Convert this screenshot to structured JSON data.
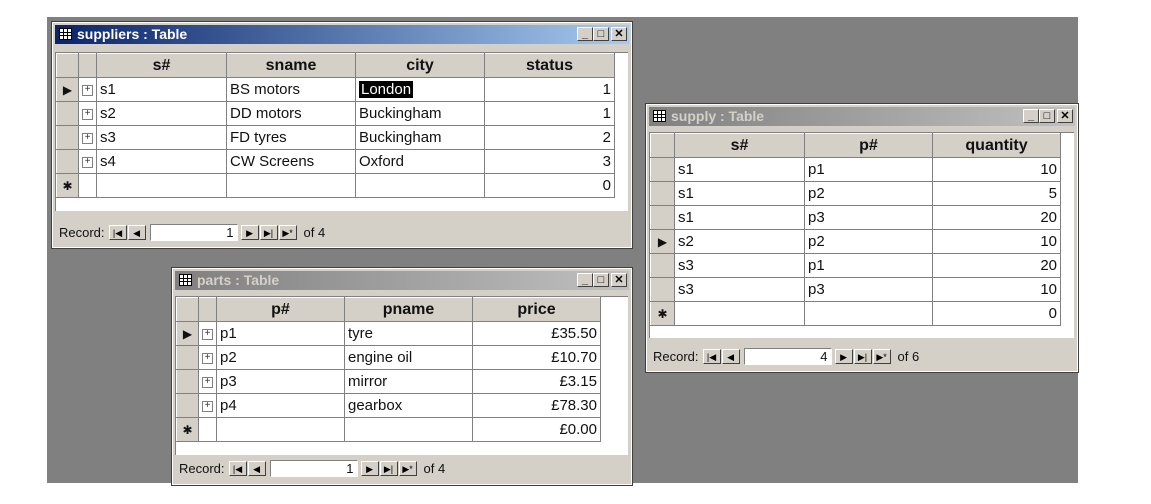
{
  "windows": {
    "suppliers": {
      "title": "suppliers : Table",
      "columns": [
        "s#",
        "sname",
        "city",
        "status"
      ],
      "rows": [
        [
          "s1",
          "BS motors",
          "London",
          "1"
        ],
        [
          "s2",
          "DD motors",
          "Buckingham",
          "1"
        ],
        [
          "s3",
          "FD tyres",
          "Buckingham",
          "2"
        ],
        [
          "s4",
          "CW Screens",
          "Oxford",
          "3"
        ]
      ],
      "new_row_default": "0",
      "record_label": "Record:",
      "record_current": "1",
      "record_of": "of 4"
    },
    "parts": {
      "title": "parts : Table",
      "columns": [
        "p#",
        "pname",
        "price"
      ],
      "rows": [
        [
          "p1",
          "tyre",
          "£35.50"
        ],
        [
          "p2",
          "engine oil",
          "£10.70"
        ],
        [
          "p3",
          "mirror",
          "£3.15"
        ],
        [
          "p4",
          "gearbox",
          "£78.30"
        ]
      ],
      "new_row_default": "£0.00",
      "record_label": "Record:",
      "record_current": "1",
      "record_of": "of 4"
    },
    "supply": {
      "title": "supply : Table",
      "columns": [
        "s#",
        "p#",
        "quantity"
      ],
      "rows": [
        [
          "s1",
          "p1",
          "10"
        ],
        [
          "s1",
          "p2",
          "5"
        ],
        [
          "s1",
          "p3",
          "20"
        ],
        [
          "s2",
          "p2",
          "10"
        ],
        [
          "s3",
          "p1",
          "20"
        ],
        [
          "s3",
          "p3",
          "10"
        ]
      ],
      "new_row_default": "0",
      "record_label": "Record:",
      "record_current": "4",
      "record_of": "of 6"
    }
  },
  "window_buttons": {
    "minimize": "_",
    "maximize": "□",
    "close": "✕"
  },
  "nav_glyphs": {
    "first": "|◀",
    "prev": "◀",
    "next": "▶",
    "last": "▶|",
    "new": "▶*"
  },
  "row_markers": {
    "current": "▶",
    "new": "✱",
    "expand": "+"
  },
  "icons": [
    "table-icon",
    "record-selector-icon",
    "expand-icon",
    "new-record-icon"
  ],
  "colors": {
    "active_title": "#0a246a",
    "inactive_title": "#808080",
    "desktop": "#808080",
    "face": "#d4d0c8"
  }
}
